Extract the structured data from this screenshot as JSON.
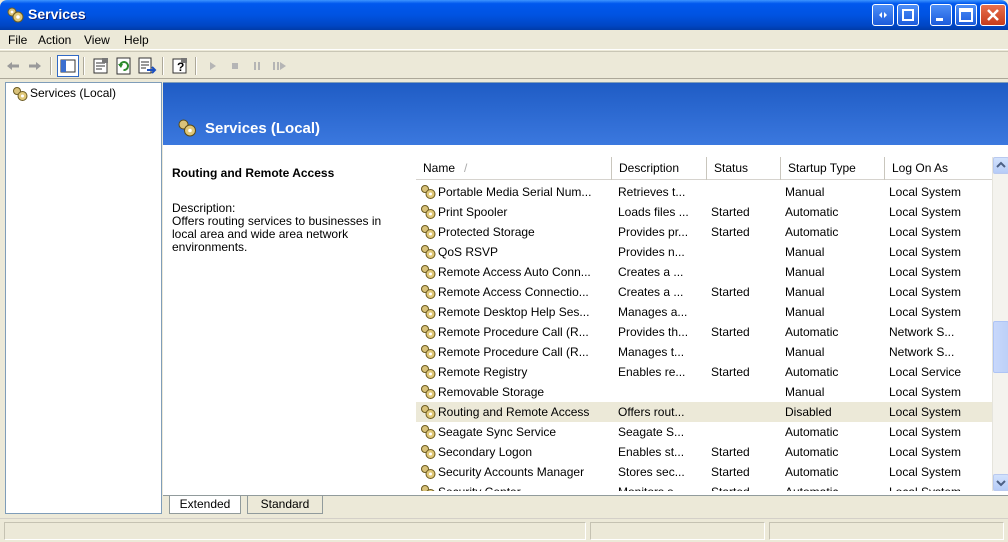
{
  "window": {
    "title": "Services"
  },
  "menu": [
    "File",
    "Action",
    "View",
    "Help"
  ],
  "toolbar": {
    "icons": [
      "back-arrow-icon",
      "forward-arrow-icon",
      "show-hide-tree-icon",
      "properties-icon",
      "refresh-icon",
      "export-list-icon",
      "help-icon",
      "start-service-icon",
      "stop-service-icon",
      "pause-service-icon",
      "restart-service-icon"
    ]
  },
  "tree": {
    "item": "Services (Local)"
  },
  "header": {
    "title": "Services (Local)"
  },
  "details": {
    "service_name": "Routing and Remote Access",
    "description_label": "Description:",
    "description": "Offers routing services to businesses in local area and wide area network environments."
  },
  "columns": {
    "name": "Name",
    "sort": "/",
    "description": "Description",
    "status": "Status",
    "startup": "Startup Type",
    "logon": "Log On As"
  },
  "services": [
    {
      "name": "Portable Media Serial Num...",
      "description": "Retrieves t...",
      "status": "",
      "startup": "Manual",
      "logon": "Local System"
    },
    {
      "name": "Print Spooler",
      "description": "Loads files ...",
      "status": "Started",
      "startup": "Automatic",
      "logon": "Local System"
    },
    {
      "name": "Protected Storage",
      "description": "Provides pr...",
      "status": "Started",
      "startup": "Automatic",
      "logon": "Local System"
    },
    {
      "name": "QoS RSVP",
      "description": "Provides n...",
      "status": "",
      "startup": "Manual",
      "logon": "Local System"
    },
    {
      "name": "Remote Access Auto Conn...",
      "description": "Creates a ...",
      "status": "",
      "startup": "Manual",
      "logon": "Local System"
    },
    {
      "name": "Remote Access Connectio...",
      "description": "Creates a ...",
      "status": "Started",
      "startup": "Manual",
      "logon": "Local System"
    },
    {
      "name": "Remote Desktop Help Ses...",
      "description": "Manages a...",
      "status": "",
      "startup": "Manual",
      "logon": "Local System"
    },
    {
      "name": "Remote Procedure Call (R...",
      "description": "Provides th...",
      "status": "Started",
      "startup": "Automatic",
      "logon": "Network S..."
    },
    {
      "name": "Remote Procedure Call (R...",
      "description": "Manages t...",
      "status": "",
      "startup": "Manual",
      "logon": "Network S..."
    },
    {
      "name": "Remote Registry",
      "description": "Enables re...",
      "status": "Started",
      "startup": "Automatic",
      "logon": "Local Service"
    },
    {
      "name": "Removable Storage",
      "description": "",
      "status": "",
      "startup": "Manual",
      "logon": "Local System"
    },
    {
      "name": "Routing and Remote Access",
      "description": "Offers rout...",
      "status": "",
      "startup": "Disabled",
      "logon": "Local System",
      "selected": true
    },
    {
      "name": "Seagate Sync Service",
      "description": "Seagate S...",
      "status": "",
      "startup": "Automatic",
      "logon": "Local System"
    },
    {
      "name": "Secondary Logon",
      "description": "Enables st...",
      "status": "Started",
      "startup": "Automatic",
      "logon": "Local System"
    },
    {
      "name": "Security Accounts Manager",
      "description": "Stores sec...",
      "status": "Started",
      "startup": "Automatic",
      "logon": "Local System"
    },
    {
      "name": "Security Center",
      "description": "Monitors s...",
      "status": "Started",
      "startup": "Automatic",
      "logon": "Local System"
    }
  ],
  "tabs": {
    "extended": "Extended",
    "standard": "Standard"
  },
  "colors": {
    "title_bar": "#0053E1",
    "header_band": "#2A67CF",
    "selected_row": "#ECE9D8"
  }
}
